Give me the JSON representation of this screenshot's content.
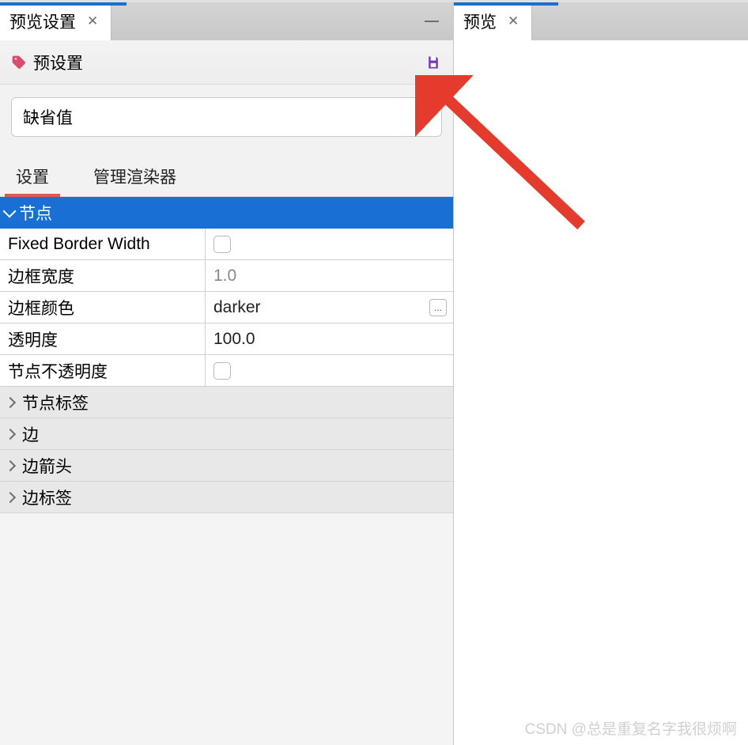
{
  "tabs": {
    "left": {
      "title": "预览设置"
    },
    "right": {
      "title": "预览"
    }
  },
  "preset": {
    "label": "预设置"
  },
  "dropdown": {
    "selected": "缺省值"
  },
  "subtabs": {
    "settings": "设置",
    "renderers": "管理渲染器"
  },
  "section": {
    "nodes": "节点"
  },
  "props": {
    "fixed_border_width": {
      "label": "Fixed Border Width"
    },
    "border_width": {
      "label": "边框宽度",
      "value": "1.0"
    },
    "border_color": {
      "label": "边框颜色",
      "value": "darker"
    },
    "opacity": {
      "label": "透明度",
      "value": "100.0"
    },
    "node_opacity": {
      "label": "节点不透明度"
    }
  },
  "groups": {
    "node_labels": "节点标签",
    "edges": "边",
    "edge_arrows": "边箭头",
    "edge_labels": "边标签"
  },
  "ellipsis": "...",
  "watermark": "CSDN @总是重复名字我很烦啊"
}
